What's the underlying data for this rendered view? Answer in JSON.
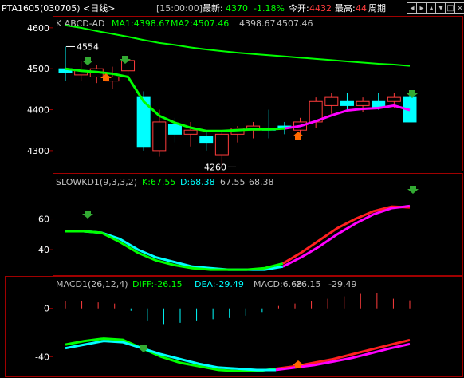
{
  "header": {
    "symbol": "PTA1605",
    "code": "(030705)",
    "period": "<日线>",
    "time": "[15:00:00]",
    "latest_label": "最新:",
    "latest_value": "4370",
    "change_pct": "-1.18%",
    "open_label": "今开:",
    "open_value": "4432",
    "high_label": "最高:",
    "high_value": "44",
    "period_label": "周期"
  },
  "panels": {
    "price": {
      "title": "K ABCD-AD",
      "ma1_label": "MA1:4398.67",
      "ma2_label": "MA2:4507.46",
      "v1": "4398.67",
      "v2": "4507.46",
      "ticks": [
        "4600",
        "4500",
        "4400",
        "4300"
      ],
      "high_label": "4554",
      "low_label": "4260"
    },
    "kd": {
      "title": "SLOWKD1(9,3,3,2)",
      "k_label": "K:67.55",
      "d_label": "D:68.38",
      "v1": "67.55",
      "v2": "68.38",
      "ticks": [
        "60",
        "40"
      ]
    },
    "macd": {
      "title": "MACD1(26,12,4)",
      "diff_label": "DIFF:-26.15",
      "dea_label": "DEA:-29.49",
      "macd_label": "MACD:6.68",
      "v1": "-26.15",
      "v2": "-29.49",
      "ticks": [
        "0",
        "-40"
      ]
    }
  },
  "colors": {
    "up": "#ff3c3c",
    "down": "#00ffff",
    "ma_green": "#00ff00",
    "magenta": "#ff00ff",
    "cyan": "#00ffff",
    "white": "#ffffff",
    "axis_red": "#a00000"
  },
  "icons": [
    "menu-left-icon",
    "menu-right-icon",
    "zoom-in-icon",
    "zoom-out-icon",
    "restore-icon",
    "close-icon"
  ],
  "chart_data": {
    "type": "candlestick",
    "price_ylim": [
      4255,
      4625
    ],
    "candles": [
      {
        "o": 4500,
        "h": 4554,
        "l": 4470,
        "c": 4490
      },
      {
        "o": 4485,
        "h": 4520,
        "l": 4470,
        "c": 4495
      },
      {
        "o": 4480,
        "h": 4510,
        "l": 4465,
        "c": 4500
      },
      {
        "o": 4470,
        "h": 4505,
        "l": 4450,
        "c": 4480
      },
      {
        "o": 4495,
        "h": 4530,
        "l": 4470,
        "c": 4520
      },
      {
        "o": 4430,
        "h": 4445,
        "l": 4300,
        "c": 4310
      },
      {
        "o": 4300,
        "h": 4400,
        "l": 4285,
        "c": 4370
      },
      {
        "o": 4365,
        "h": 4380,
        "l": 4320,
        "c": 4340
      },
      {
        "o": 4340,
        "h": 4370,
        "l": 4310,
        "c": 4350
      },
      {
        "o": 4335,
        "h": 4345,
        "l": 4300,
        "c": 4320
      },
      {
        "o": 4290,
        "h": 4350,
        "l": 4260,
        "c": 4340
      },
      {
        "o": 4340,
        "h": 4360,
        "l": 4320,
        "c": 4355
      },
      {
        "o": 4350,
        "h": 4370,
        "l": 4330,
        "c": 4360
      },
      {
        "o": 4355,
        "h": 4400,
        "l": 4330,
        "c": 4350
      },
      {
        "o": 4360,
        "h": 4370,
        "l": 4340,
        "c": 4355
      },
      {
        "o": 4350,
        "h": 4380,
        "l": 4330,
        "c": 4370
      },
      {
        "o": 4370,
        "h": 4430,
        "l": 4355,
        "c": 4420
      },
      {
        "o": 4410,
        "h": 4440,
        "l": 4390,
        "c": 4430
      },
      {
        "o": 4420,
        "h": 4440,
        "l": 4400,
        "c": 4410
      },
      {
        "o": 4410,
        "h": 4430,
        "l": 4395,
        "c": 4420
      },
      {
        "o": 4420,
        "h": 4440,
        "l": 4400,
        "c": 4405
      },
      {
        "o": 4420,
        "h": 4440,
        "l": 4405,
        "c": 4430
      },
      {
        "o": 4430,
        "h": 4445,
        "l": 4390,
        "c": 4370
      }
    ],
    "ma1": [
      4500,
      4495,
      4492,
      4488,
      4480,
      4420,
      4385,
      4368,
      4356,
      4348,
      4348,
      4350,
      4352,
      4352,
      4354,
      4360,
      4372,
      4386,
      4398,
      4402,
      4404,
      4410,
      4399
    ],
    "ma2": [
      4606,
      4600,
      4592,
      4585,
      4578,
      4570,
      4563,
      4558,
      4552,
      4547,
      4543,
      4539,
      4536,
      4533,
      4530,
      4527,
      4524,
      4521,
      4518,
      4515,
      4512,
      4510,
      4507
    ],
    "kd_ylim": [
      25,
      80
    ],
    "k": [
      52,
      52,
      51,
      45,
      38,
      33,
      30,
      28,
      27,
      27,
      27,
      28,
      31,
      38,
      46,
      54,
      60,
      65,
      68,
      67.5
    ],
    "d": [
      52,
      52,
      51,
      47,
      40,
      35,
      32,
      29,
      28,
      27,
      27,
      27,
      29,
      35,
      42,
      50,
      57,
      63,
      67,
      68.4
    ],
    "macd_ylim": [
      -55,
      15
    ],
    "diff": [
      -30,
      -27,
      -25,
      -26,
      -33,
      -40,
      -45,
      -48,
      -51,
      -52,
      -52,
      -50,
      -48,
      -45,
      -42,
      -38,
      -34,
      -30,
      -26.15
    ],
    "dea": [
      -33,
      -30,
      -27,
      -28,
      -33,
      -38,
      -42,
      -46,
      -49,
      -50,
      -51,
      -51,
      -49,
      -47,
      -44,
      -41,
      -37,
      -33,
      -29.49
    ],
    "macd": [
      6,
      6,
      5,
      4,
      -2,
      -10,
      -13,
      -12,
      -10,
      -9,
      -8,
      -6,
      -3,
      2,
      4,
      6,
      8,
      10,
      12,
      13,
      8,
      6.68
    ],
    "x": [
      1,
      2,
      3,
      4,
      5,
      6,
      7,
      8,
      9,
      10,
      11,
      12,
      13,
      14,
      15,
      16,
      17,
      18,
      19,
      20,
      21,
      22,
      23
    ]
  }
}
